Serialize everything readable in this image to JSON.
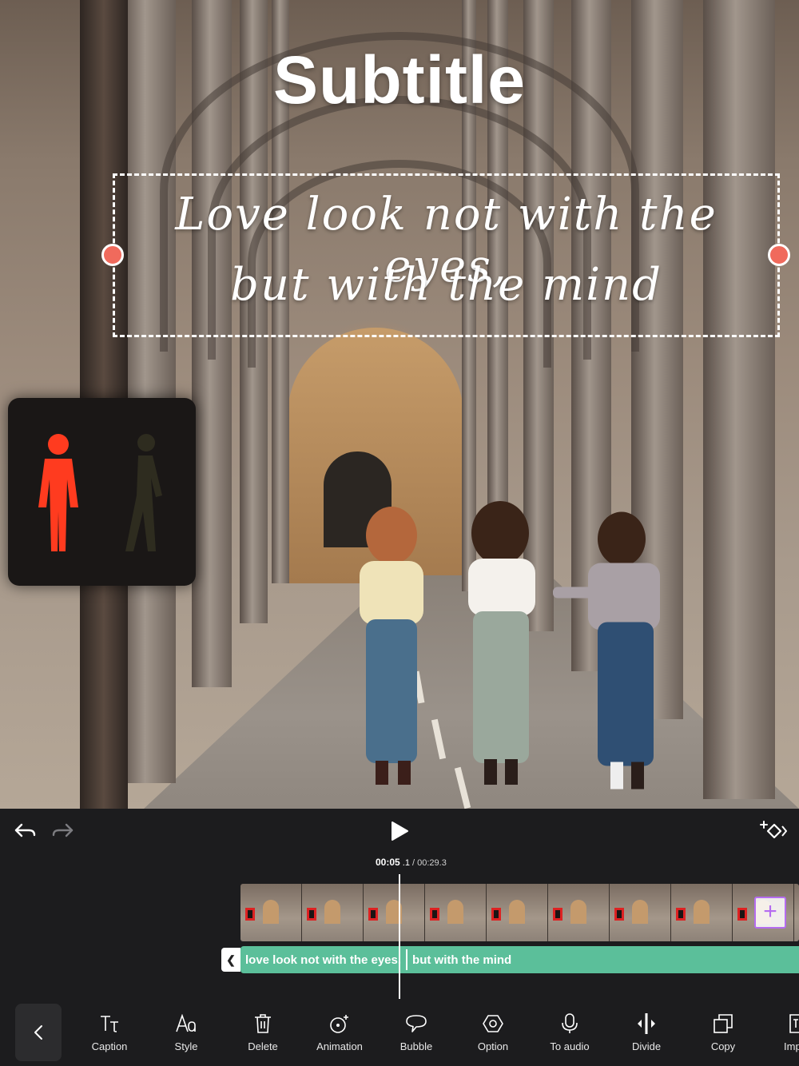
{
  "canvas": {
    "title_text": "Subtitle",
    "caption_line_1": "Love look not with the eyes,",
    "caption_line_2": "but with the mind"
  },
  "controls": {
    "undo_icon": "undo-icon",
    "redo_icon": "redo-icon",
    "play_icon": "play-icon",
    "keyframe_icon": "add-keyframe-icon"
  },
  "timeline": {
    "current_time": "00:05",
    "current_frame": ".1",
    "separator": "/",
    "total_time": "00:29.3",
    "caption_segments": [
      "love look not with the eyes,",
      "but with the mind"
    ],
    "caption_track_color": "#5bbf9a",
    "add_clip_icon": "plus-icon"
  },
  "toolbar": {
    "back_icon": "chevron-left-icon",
    "tools": [
      {
        "label": "Caption",
        "icon": "caption-icon"
      },
      {
        "label": "Style",
        "icon": "style-icon"
      },
      {
        "label": "Delete",
        "icon": "trash-icon"
      },
      {
        "label": "Animation",
        "icon": "animation-icon"
      },
      {
        "label": "Bubble",
        "icon": "bubble-icon"
      },
      {
        "label": "Option",
        "icon": "option-icon"
      },
      {
        "label": "To audio",
        "icon": "microphone-icon"
      },
      {
        "label": "Divide",
        "icon": "divide-icon"
      },
      {
        "label": "Copy",
        "icon": "copy-icon"
      },
      {
        "label": "Imp",
        "icon": "import-icon"
      }
    ]
  },
  "colors": {
    "accent_handle": "#f06a5c",
    "add_clip_border": "#b56cf0",
    "background": "#1c1c1e"
  }
}
